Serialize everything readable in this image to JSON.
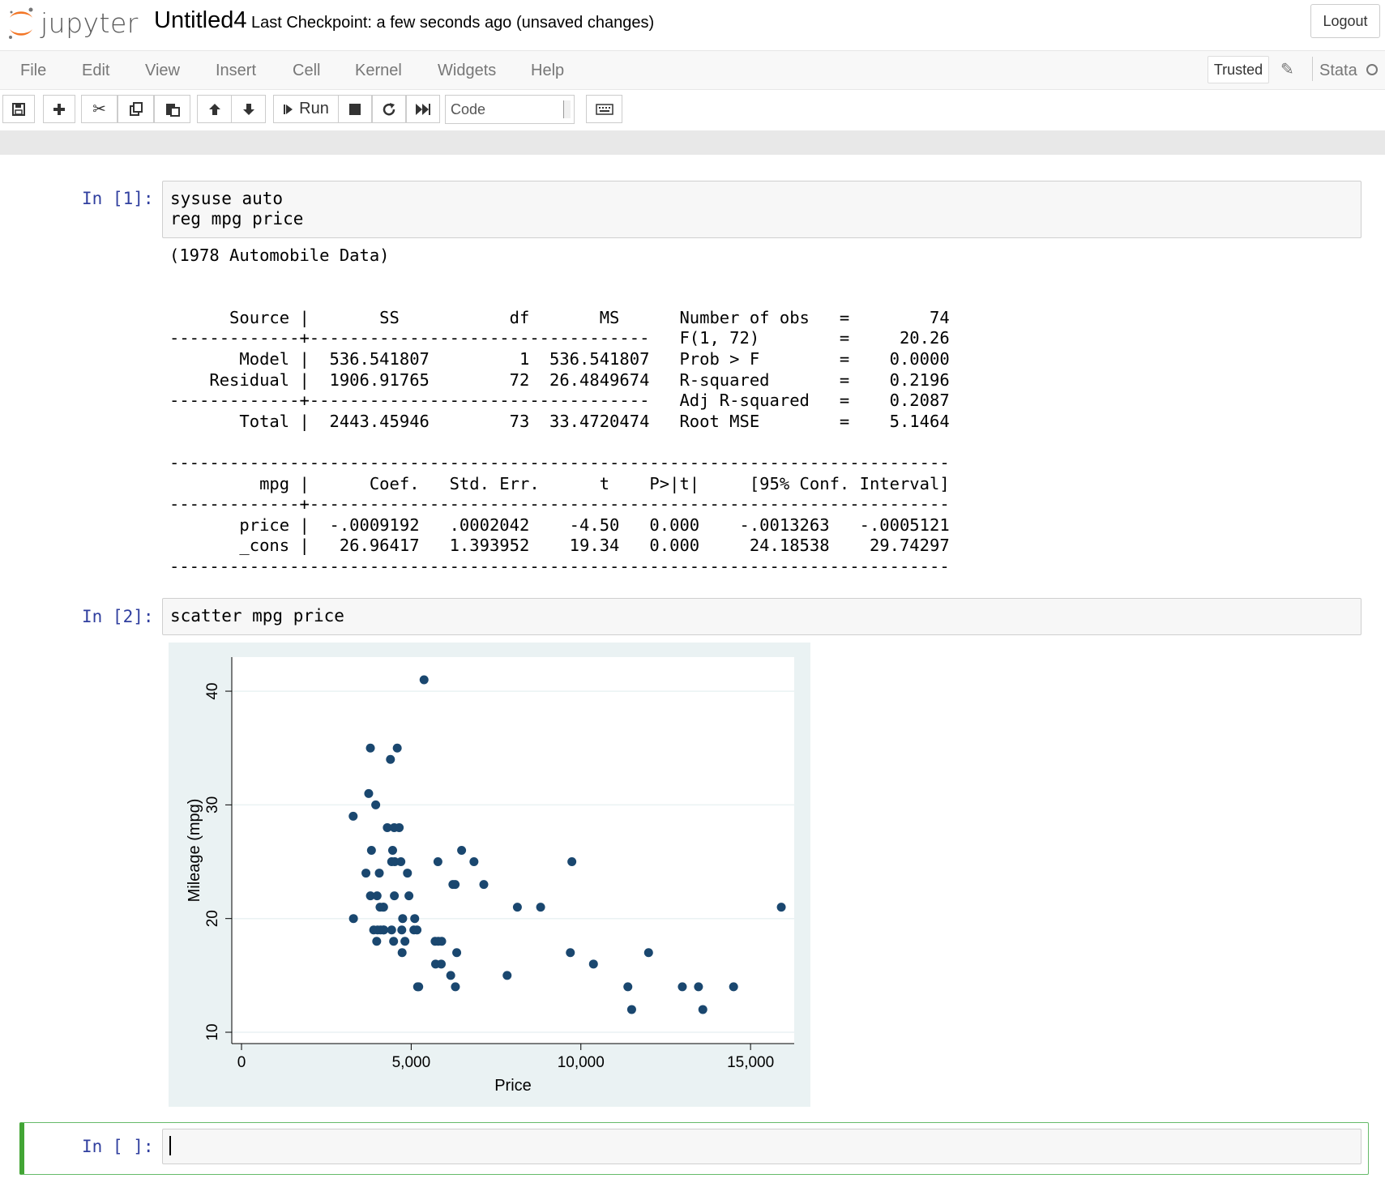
{
  "header": {
    "logo_text": "jupyter",
    "notebook_name": "Untitled4",
    "checkpoint": "Last Checkpoint: a few seconds ago",
    "unsaved": "(unsaved changes)",
    "logout_label": "Logout"
  },
  "menubar": {
    "items": [
      "File",
      "Edit",
      "View",
      "Insert",
      "Cell",
      "Kernel",
      "Widgets",
      "Help"
    ],
    "trusted_label": "Trusted",
    "kernel_name": "Stata"
  },
  "toolbar": {
    "run_label": "Run",
    "cell_type": "Code",
    "icons": [
      "save-icon",
      "add-cell-icon",
      "cut-icon",
      "copy-icon",
      "paste-icon",
      "move-up-icon",
      "move-down-icon",
      "run-icon",
      "stop-icon",
      "restart-icon",
      "fast-forward-icon",
      "keyboard-icon"
    ]
  },
  "cells": [
    {
      "prompt": "In [1]:",
      "code": "sysuse auto\nreg mpg price",
      "output": "(1978 Automobile Data)\n\n\n      Source |       SS           df       MS      Number of obs   =        74\n-------------+----------------------------------   F(1, 72)        =     20.26\n       Model |  536.541807         1  536.541807   Prob > F        =    0.0000\n    Residual |  1906.91765        72  26.4849674   R-squared       =    0.2196\n-------------+----------------------------------   Adj R-squared   =    0.2087\n       Total |  2443.45946        73  33.4720474   Root MSE        =    5.1464\n\n------------------------------------------------------------------------------\n         mpg |      Coef.   Std. Err.      t    P>|t|     [95% Conf. Interval]\n-------------+----------------------------------------------------------------\n       price |  -.0009192   .0002042    -4.50   0.000    -.0013263   -.0005121\n       _cons |   26.96417   1.393952    19.34   0.000     24.18538    29.74297\n------------------------------------------------------------------------------"
    },
    {
      "prompt": "In [2]:",
      "code": "scatter mpg price"
    },
    {
      "prompt": "In [ ]:",
      "code": ""
    }
  ],
  "chart_data": {
    "type": "scatter",
    "xlabel": "Price",
    "ylabel": "Mileage (mpg)",
    "xlim": [
      0,
      16000
    ],
    "ylim": [
      10,
      42
    ],
    "xticks": [
      0,
      5000,
      10000,
      15000
    ],
    "xtick_labels": [
      "0",
      "5,000",
      "10,000",
      "15,000"
    ],
    "yticks": [
      10,
      20,
      30,
      40
    ],
    "ytick_labels": [
      "10",
      "20",
      "30",
      "40"
    ],
    "grid": "horizontal",
    "colors": {
      "point": "#1a476f",
      "plot_bg": "#ffffff",
      "outer_bg": "#eaf2f3",
      "grid": "#eaf2f3"
    },
    "points": [
      [
        3291,
        29
      ],
      [
        3299,
        20
      ],
      [
        3667,
        24
      ],
      [
        3748,
        31
      ],
      [
        3798,
        35
      ],
      [
        3799,
        22
      ],
      [
        3829,
        26
      ],
      [
        3895,
        19
      ],
      [
        3955,
        30
      ],
      [
        3984,
        18
      ],
      [
        3995,
        22
      ],
      [
        4010,
        19
      ],
      [
        4060,
        24
      ],
      [
        4082,
        21
      ],
      [
        4099,
        19
      ],
      [
        4172,
        21
      ],
      [
        4181,
        19
      ],
      [
        4187,
        21
      ],
      [
        4195,
        19
      ],
      [
        4296,
        28
      ],
      [
        4389,
        34
      ],
      [
        4424,
        19
      ],
      [
        4425,
        25
      ],
      [
        4453,
        26
      ],
      [
        4482,
        18
      ],
      [
        4499,
        28
      ],
      [
        4504,
        22
      ],
      [
        4516,
        25
      ],
      [
        4589,
        35
      ],
      [
        4647,
        28
      ],
      [
        4697,
        25
      ],
      [
        4723,
        19
      ],
      [
        4733,
        17
      ],
      [
        4749,
        20
      ],
      [
        4816,
        18
      ],
      [
        4890,
        24
      ],
      [
        4934,
        22
      ],
      [
        5079,
        19
      ],
      [
        5104,
        20
      ],
      [
        5172,
        19
      ],
      [
        5189,
        14
      ],
      [
        5222,
        14
      ],
      [
        5379,
        41
      ],
      [
        5705,
        18
      ],
      [
        5719,
        16
      ],
      [
        5788,
        25
      ],
      [
        5798,
        18
      ],
      [
        5886,
        16
      ],
      [
        5899,
        18
      ],
      [
        6165,
        15
      ],
      [
        6229,
        23
      ],
      [
        6295,
        23
      ],
      [
        6303,
        14
      ],
      [
        6342,
        17
      ],
      [
        6486,
        26
      ],
      [
        6850,
        25
      ],
      [
        7140,
        23
      ],
      [
        7827,
        15
      ],
      [
        8129,
        21
      ],
      [
        8814,
        21
      ],
      [
        9690,
        17
      ],
      [
        9735,
        25
      ],
      [
        10371,
        16
      ],
      [
        11385,
        14
      ],
      [
        11497,
        12
      ],
      [
        11995,
        17
      ],
      [
        12990,
        14
      ],
      [
        13466,
        14
      ],
      [
        13594,
        12
      ],
      [
        14500,
        14
      ],
      [
        15906,
        21
      ]
    ]
  }
}
